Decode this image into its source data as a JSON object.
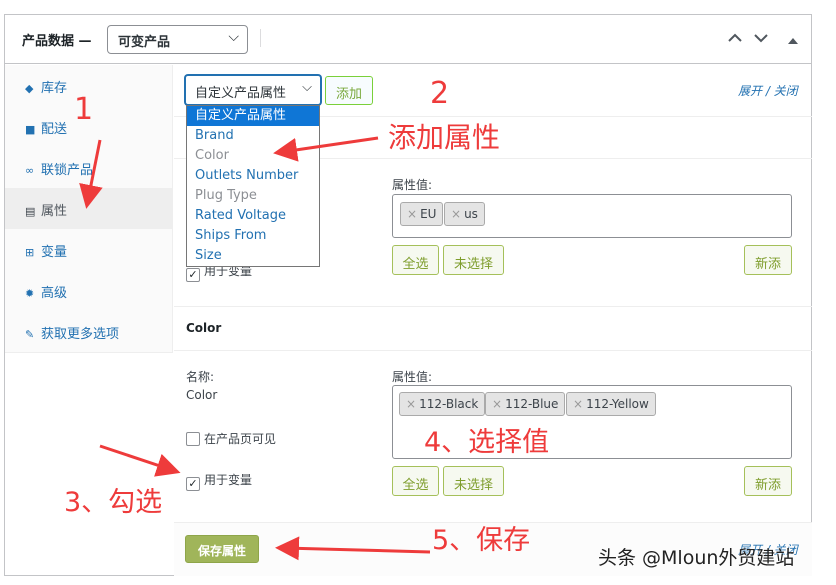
{
  "header": {
    "title": "产品数据 —",
    "product_type": "可变产品",
    "up_ctrl": "⌃",
    "down_ctrl": "⌄",
    "toggle_ctrl": "▲"
  },
  "sidebar": {
    "items": [
      {
        "label": "库存",
        "icon": "diamond-icon"
      },
      {
        "label": "配送",
        "icon": "truck-icon"
      },
      {
        "label": "联锁产品",
        "icon": "link-icon"
      },
      {
        "label": "属性",
        "icon": "list-icon"
      },
      {
        "label": "变量",
        "icon": "grid-icon"
      },
      {
        "label": "高级",
        "icon": "gear-icon"
      },
      {
        "label": "获取更多选项",
        "icon": "plugin-icon"
      }
    ]
  },
  "toolbar": {
    "attribute_select": "自定义产品属性",
    "add_button": "添加",
    "expand_close": "展开 / 关闭"
  },
  "dropdown": {
    "options": [
      "自定义产品属性",
      "Brand",
      "Color",
      "Outlets Number",
      "Plug Type",
      "Rated Voltage",
      "Ships From",
      "Size"
    ]
  },
  "attr1": {
    "values_label": "属性值:",
    "chips": [
      "EU",
      "us"
    ],
    "use_for_variations": "用于变量",
    "select_all": "全选",
    "select_none": "未选择",
    "add_new": "新添"
  },
  "attr2": {
    "section_title": "Color",
    "name_label": "名称:",
    "name_value": "Color",
    "values_label": "属性值:",
    "chips": [
      "112-Black",
      "112-Blue",
      "112-Yellow"
    ],
    "visible_on_product_page": "在产品页可见",
    "use_for_variations": "用于变量",
    "select_all": "全选",
    "select_none": "未选择",
    "add_new": "新添"
  },
  "footer": {
    "save_button": "保存属性",
    "expand_close": "展开 / 关闭"
  },
  "annotations": {
    "n1": "1",
    "n2": "2",
    "add_attr": "添加属性",
    "step3": "3、勾选",
    "step4": "4、选择值",
    "step5": "5、保存",
    "annotation_color": "#ee3b3b"
  },
  "watermark": "头条 @Mloun外贸建站",
  "colors": {
    "link_blue": "#2271b1",
    "dropdown_selected": "#0f76d6",
    "save_button": "#a0b55a"
  }
}
